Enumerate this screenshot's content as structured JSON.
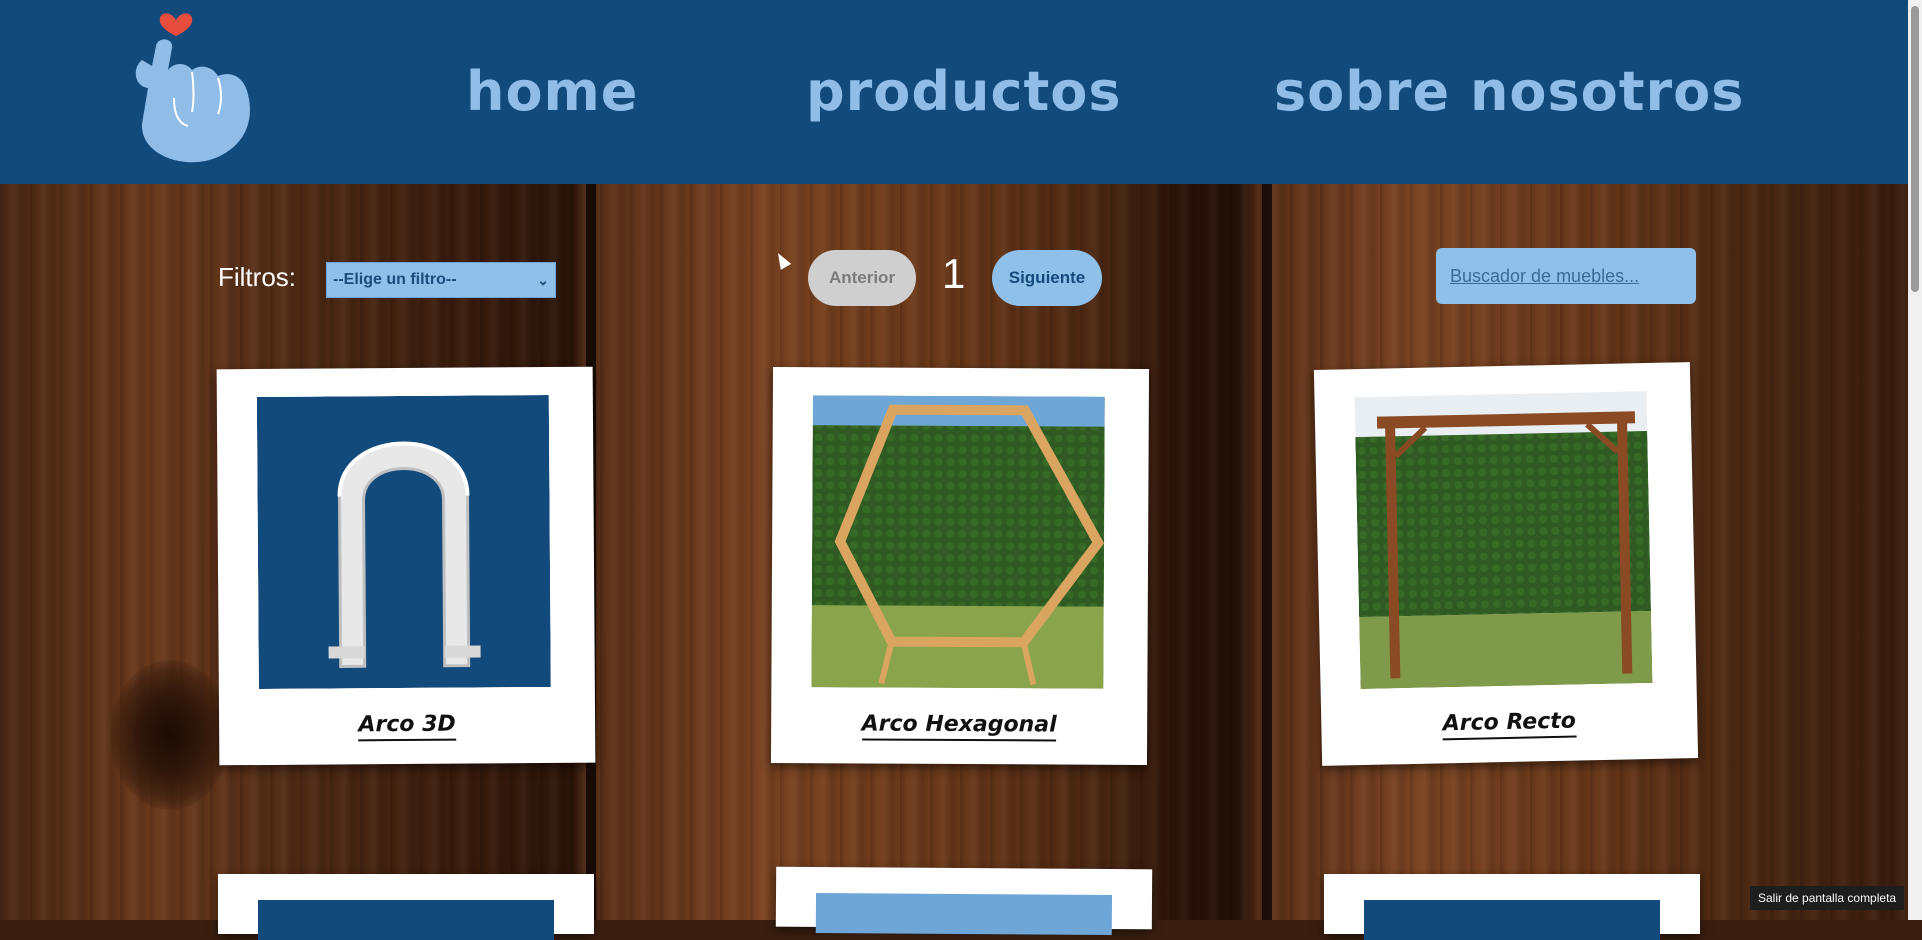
{
  "nav": {
    "home": "home",
    "productos": "productos",
    "sobre_nosotros": "sobre nosotros"
  },
  "colors": {
    "header_bg": "#134a7c",
    "nav_text": "#8fbde8",
    "accent_light_blue": "#8fc0ea",
    "logo_heart": "#e74c3c"
  },
  "controls": {
    "filters_label": "Filtros:",
    "filter_selected": "--Elige un filtro--",
    "prev_label": "Anterior",
    "page_number": "1",
    "next_label": "Siguiente",
    "search_placeholder": "Buscador de muebles..."
  },
  "products": [
    {
      "name": "Arco 3D",
      "image": "white-3d-arch-render"
    },
    {
      "name": "Arco Hexagonal",
      "image": "wooden-hexagonal-arch-photo"
    },
    {
      "name": "Arco Recto",
      "image": "wooden-straight-arch-photo"
    }
  ],
  "overlay": {
    "exit_fullscreen": "Salir de pantalla completa"
  },
  "icons": {
    "logo": "finger-heart-logo-icon",
    "select_arrow": "chevron-down-icon",
    "cursor": "mouse-pointer-icon"
  }
}
